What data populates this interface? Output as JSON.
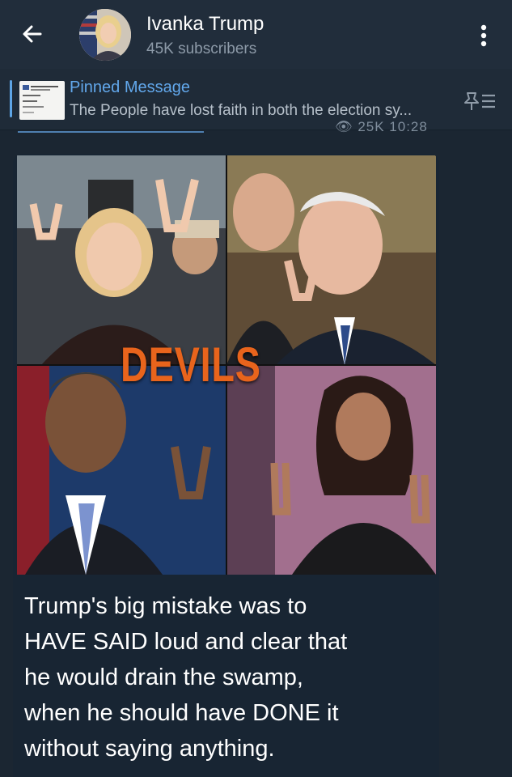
{
  "header": {
    "channel_name": "Ivanka Trump",
    "subscribers": "45K subscribers"
  },
  "pinned": {
    "title": "Pinned Message",
    "text": "The People have lost faith in both the election sy..."
  },
  "previous_message": {
    "meta": "25K  10:28"
  },
  "post": {
    "image_text": "DEVILS",
    "caption_lines": [
      "Trump's big mistake was to",
      "HAVE SAID loud and clear that",
      "he would drain the swamp,",
      "when he should have DONE it",
      "without saying anything."
    ]
  },
  "icons": {
    "back": "arrow-left-icon",
    "menu": "more-vertical-icon",
    "unpin": "pin-list-icon"
  },
  "colors": {
    "background": "#1b2632",
    "header": "#212d3b",
    "accent": "#62a8ec",
    "overlay_text": "#e8641c"
  }
}
